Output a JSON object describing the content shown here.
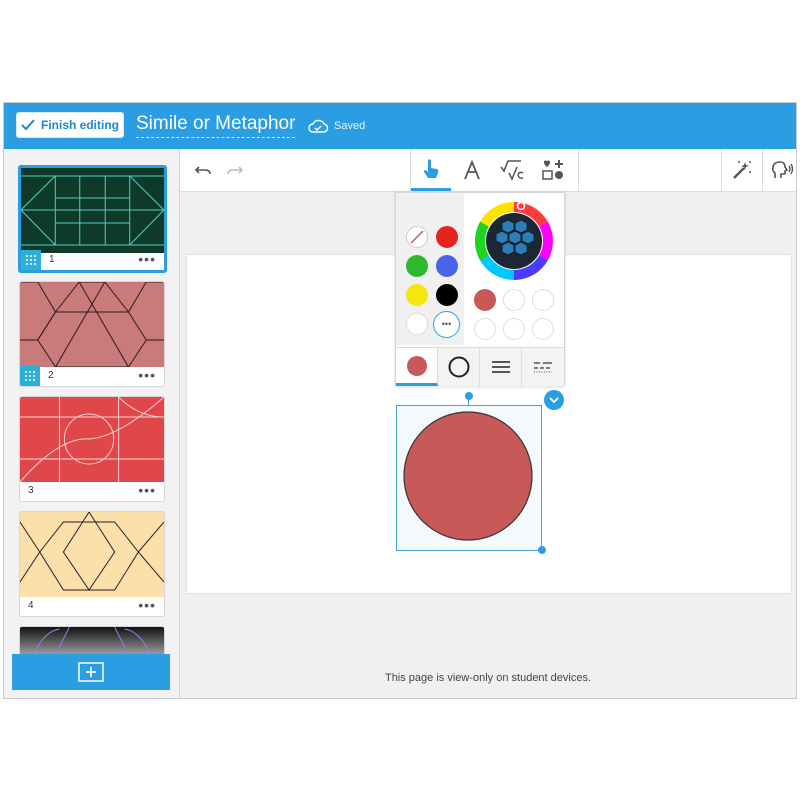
{
  "header": {
    "finish_label": "Finish editing",
    "title": "Simile or Metaphor",
    "saved_label": "Saved"
  },
  "sidebar": {
    "pages": [
      {
        "number": "1",
        "menu": "•••",
        "background": "#0f3a2a",
        "selected": true
      },
      {
        "number": "2",
        "menu": "•••",
        "background": "#c97b7b",
        "selected": false
      },
      {
        "number": "3",
        "menu": "•••",
        "background": "#e0474a",
        "selected": false
      },
      {
        "number": "4",
        "menu": "•••",
        "background": "#fbe0a9",
        "selected": false
      }
    ]
  },
  "toolbar": {
    "tools": [
      "undo-icon",
      "redo-icon",
      "pointer-hand-icon",
      "text-icon",
      "math-icon",
      "media-icon",
      "magic-wand-icon",
      "voice-icon"
    ],
    "active_tool": "pointer-hand-icon"
  },
  "color_popup": {
    "basic_colors": [
      "none",
      "#e8231f",
      "#2eb82e",
      "#4a64e8",
      "#f5e60d",
      "#000000",
      "#ffffff",
      "more"
    ],
    "more_label": "•••",
    "recent_colors": [
      "#c75a59",
      "#ffffff",
      "#ffffff",
      "#ffffff",
      "#ffffff",
      "#ffffff"
    ],
    "tabs": [
      "fill-tab",
      "outline-tab",
      "stroke-weight-tab",
      "dash-style-tab"
    ],
    "active_tab": "fill-tab"
  },
  "shape": {
    "type": "circle",
    "fill": "#c75a59",
    "stroke": "#333333"
  },
  "footer": {
    "view_only_note": "This page is view-only on student devices."
  },
  "colors": {
    "accent": "#2b9ee3"
  }
}
